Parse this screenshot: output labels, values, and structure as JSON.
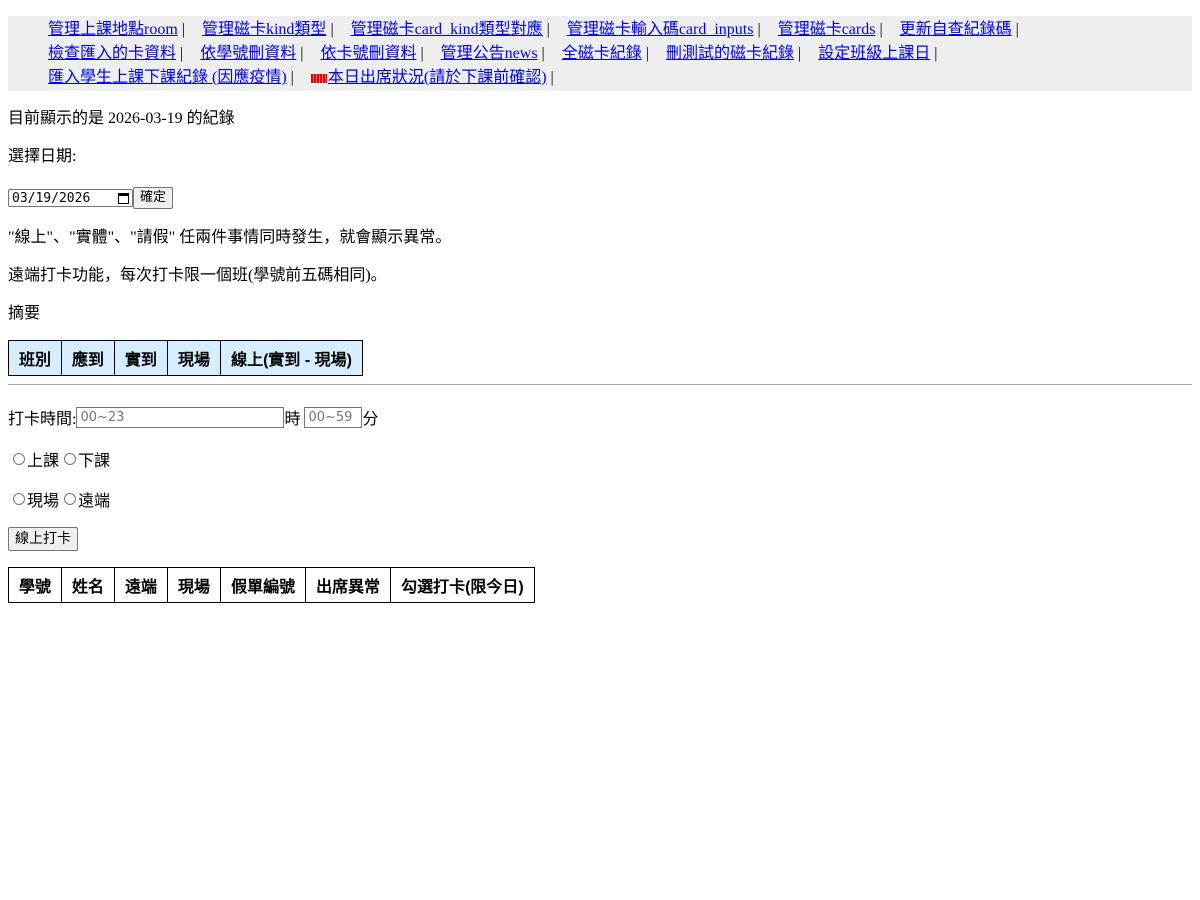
{
  "nav": {
    "items": [
      {
        "label": "管理上課地點room"
      },
      {
        "label": "管理磁卡kind類型"
      },
      {
        "label": "管理磁卡card_kind類型對應"
      },
      {
        "label": "管理磁卡輸入碼card_inputs"
      },
      {
        "label": "管理磁卡cards"
      },
      {
        "label": "更新自查紀錄碼"
      },
      {
        "label": "檢查匯入的卡資料"
      },
      {
        "label": "依學號刪資料"
      },
      {
        "label": "依卡號刪資料"
      },
      {
        "label": "管理公告news"
      },
      {
        "label": "全磁卡紀錄"
      },
      {
        "label": "刪測試的磁卡紀錄"
      },
      {
        "label": "設定班級上課日"
      },
      {
        "label": "匯入學生上課下課紀錄 (因應疫情)"
      },
      {
        "label": "本日出席狀況(請於下課前確認)",
        "badge": "new"
      }
    ],
    "separator": "|"
  },
  "status": {
    "showing_prefix": "目前顯示的是",
    "date": "2026-03-19",
    "showing_suffix": "的紀錄"
  },
  "date_picker": {
    "label": "選擇日期:",
    "value": "03/19/2026",
    "confirm_label": "確定"
  },
  "notes": {
    "anomaly": "\"線上\"、\"實體\"、\"請假\" 任兩件事情同時發生，就會顯示異常。",
    "remote": "遠端打卡功能，每次打卡限一個班(學號前五碼相同)。"
  },
  "summary": {
    "title": "摘要",
    "columns": [
      "班別",
      "應到",
      "實到",
      "現場",
      "線上(實到 - 現場)"
    ]
  },
  "punch": {
    "time_label": "打卡時間:",
    "hour_placeholder": "00~23",
    "hour_unit": "時",
    "minute_placeholder": "00~59",
    "minute_unit": "分",
    "type_options": [
      "上課",
      "下課"
    ],
    "location_options": [
      "現場",
      "遠端"
    ],
    "submit_label": "線上打卡"
  },
  "records": {
    "columns": [
      "學號",
      "姓名",
      "遠端",
      "現場",
      "假單編號",
      "出席異常",
      "勾選打卡(限今日)"
    ]
  },
  "colors": {
    "nav_bg": "#eeeeee",
    "link": "#0000ee",
    "summary_header_bg": "#d6ecff"
  }
}
